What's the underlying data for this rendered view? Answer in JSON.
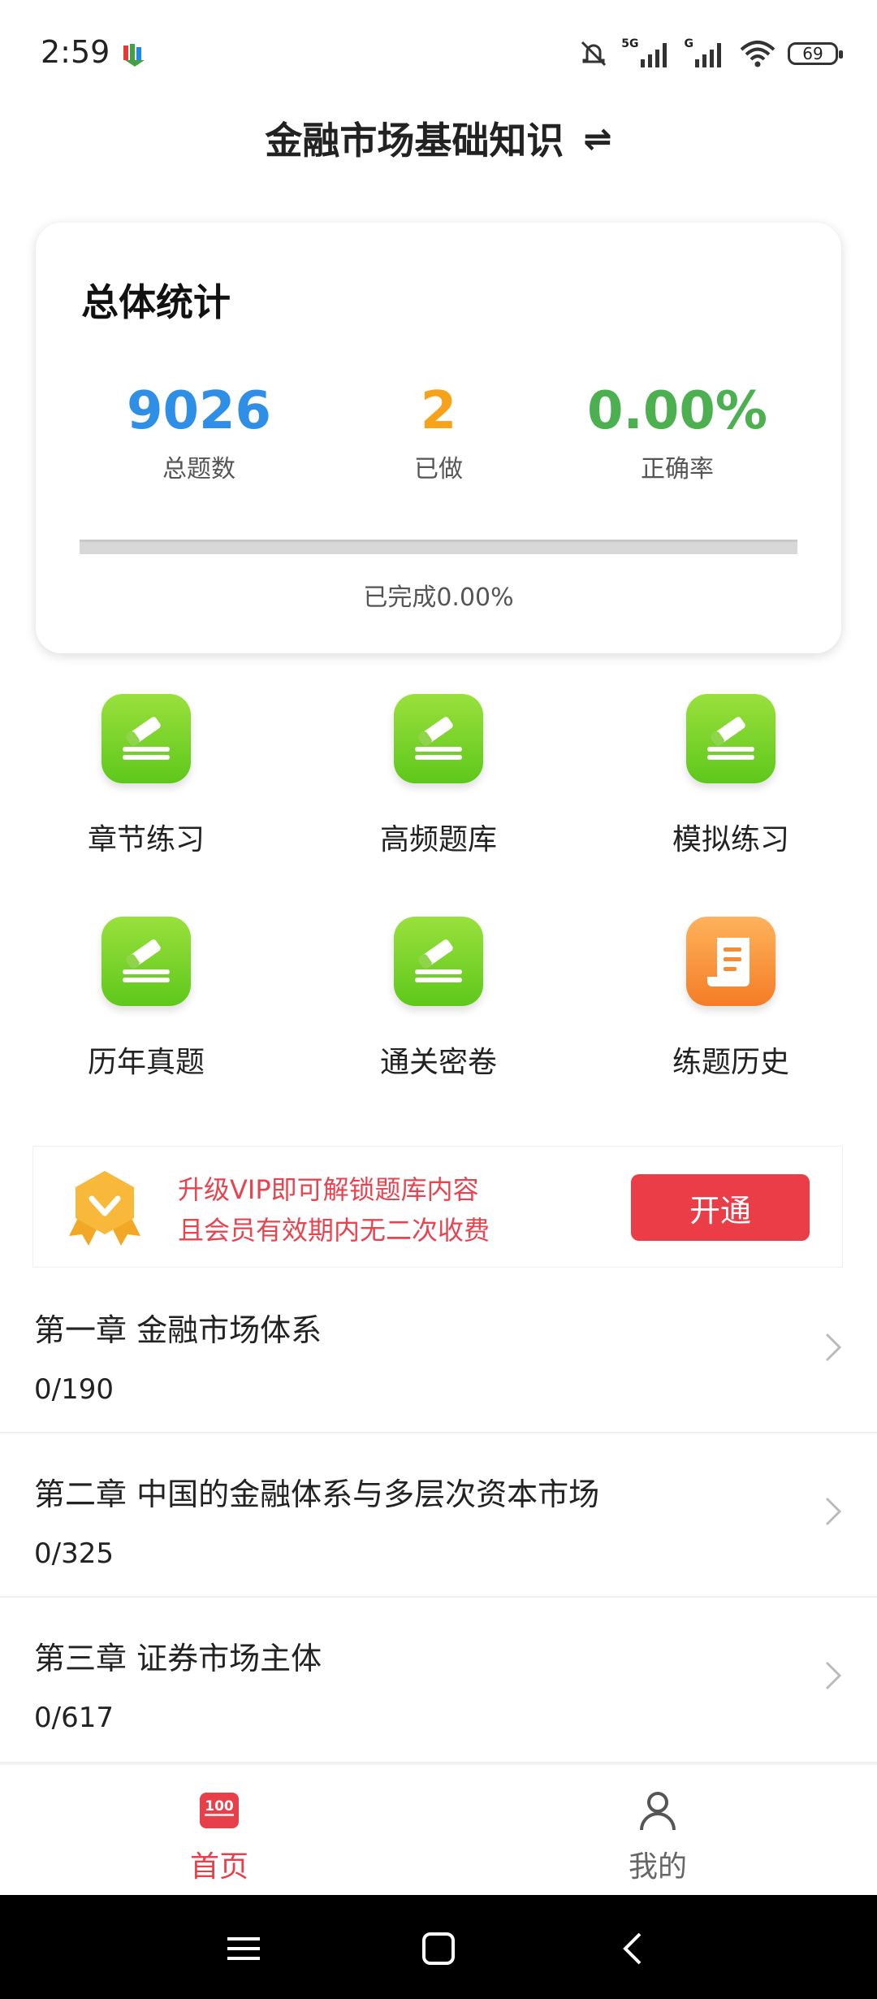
{
  "status": {
    "time": "2:59",
    "sig1": "5G",
    "sig2": "G",
    "battery": "69"
  },
  "header": {
    "title": "金融市场基础知识",
    "switch_icon": "⇌"
  },
  "stats": {
    "title": "总体统计",
    "items": [
      {
        "value": "9026",
        "label": "总题数",
        "color": "#2f8fe6"
      },
      {
        "value": "2",
        "label": "已做",
        "color": "#f7a21b"
      },
      {
        "value": "0.00%",
        "label": "正确率",
        "color": "#4caf50"
      }
    ],
    "progress_fraction": 0.0,
    "progress_text": "已完成0.00%"
  },
  "features": [
    {
      "label": "章节练习",
      "icon": "edit-icon"
    },
    {
      "label": "高频题库",
      "icon": "edit-icon"
    },
    {
      "label": "模拟练习",
      "icon": "edit-icon"
    },
    {
      "label": "历年真题",
      "icon": "edit-icon"
    },
    {
      "label": "通关密卷",
      "icon": "edit-icon"
    },
    {
      "label": "练题历史",
      "icon": "scroll-icon"
    }
  ],
  "vip": {
    "line1": "升级VIP即可解锁题库内容",
    "line2": "且会员有效期内无二次收费",
    "button": "开通",
    "icon": "vip-badge-icon"
  },
  "chapters": [
    {
      "title": "第一章 金融市场体系",
      "count": "0/190"
    },
    {
      "title": "第二章 中国的金融体系与多层次资本市场",
      "count": "0/325"
    },
    {
      "title": "第三章 证券市场主体",
      "count": "0/617"
    }
  ],
  "nav": [
    {
      "label": "首页",
      "icon": "home-100-icon",
      "active": true,
      "color": "#e8404a"
    },
    {
      "label": "我的",
      "icon": "person-icon",
      "active": false,
      "color": "#666666"
    }
  ],
  "nav_badge": "100"
}
